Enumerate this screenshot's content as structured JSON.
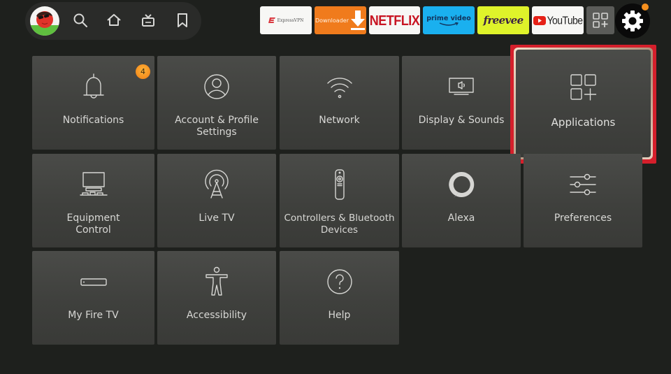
{
  "top_bar": {
    "profile": {
      "icon": "profile-avatar-icon"
    },
    "nav_icons": [
      {
        "name": "search",
        "icon": "search-icon"
      },
      {
        "name": "home",
        "icon": "home-icon"
      },
      {
        "name": "live",
        "icon": "live-tv-icon"
      },
      {
        "name": "watchlist",
        "icon": "bookmark-icon"
      }
    ],
    "apps": [
      {
        "name": "ExpressVPN",
        "label": "ExpressVPN",
        "color": "#f7f7f5",
        "accent": "#da3940"
      },
      {
        "name": "Downloader",
        "label": "Downloader",
        "color": "#f07b1c"
      },
      {
        "name": "Netflix",
        "label": "NETFLIX",
        "color": "#f7f7f5",
        "accent": "#c81523"
      },
      {
        "name": "Prime Video",
        "label": "prime video",
        "color": "#1ab0ef"
      },
      {
        "name": "Freevee",
        "label": "freevee",
        "color": "#dff32a"
      },
      {
        "name": "YouTube",
        "label": "YouTube",
        "color": "#f7f7f5",
        "accent": "#e62117"
      }
    ],
    "all_apps": {
      "icon": "apps-grid-icon"
    },
    "settings": {
      "icon": "gear-icon",
      "has_alert_dot": true,
      "alert_color": "#f5901e"
    }
  },
  "settings_grid": {
    "focused": "Applications",
    "focus_color": "#d51f2b",
    "tiles": [
      {
        "label": "Notifications",
        "icon": "bell-icon",
        "badge": "4"
      },
      {
        "label": "Account & Profile Settings",
        "icon": "user-circle-icon"
      },
      {
        "label": "Network",
        "icon": "wifi-icon"
      },
      {
        "label": "Display & Sounds",
        "icon": "display-sound-icon"
      },
      {
        "label": "Applications",
        "icon": "apps-add-icon"
      },
      {
        "label": "Equipment Control",
        "icon": "equipment-icon"
      },
      {
        "label": "Live TV",
        "icon": "antenna-icon"
      },
      {
        "label": "Controllers & Bluetooth Devices",
        "icon": "remote-icon"
      },
      {
        "label": "Alexa",
        "icon": "alexa-icon"
      },
      {
        "label": "Preferences",
        "icon": "sliders-icon"
      },
      {
        "label": "My Fire TV",
        "icon": "fire-tv-stick-icon"
      },
      {
        "label": "Accessibility",
        "icon": "accessibility-icon"
      },
      {
        "label": "Help",
        "icon": "help-icon"
      }
    ]
  }
}
